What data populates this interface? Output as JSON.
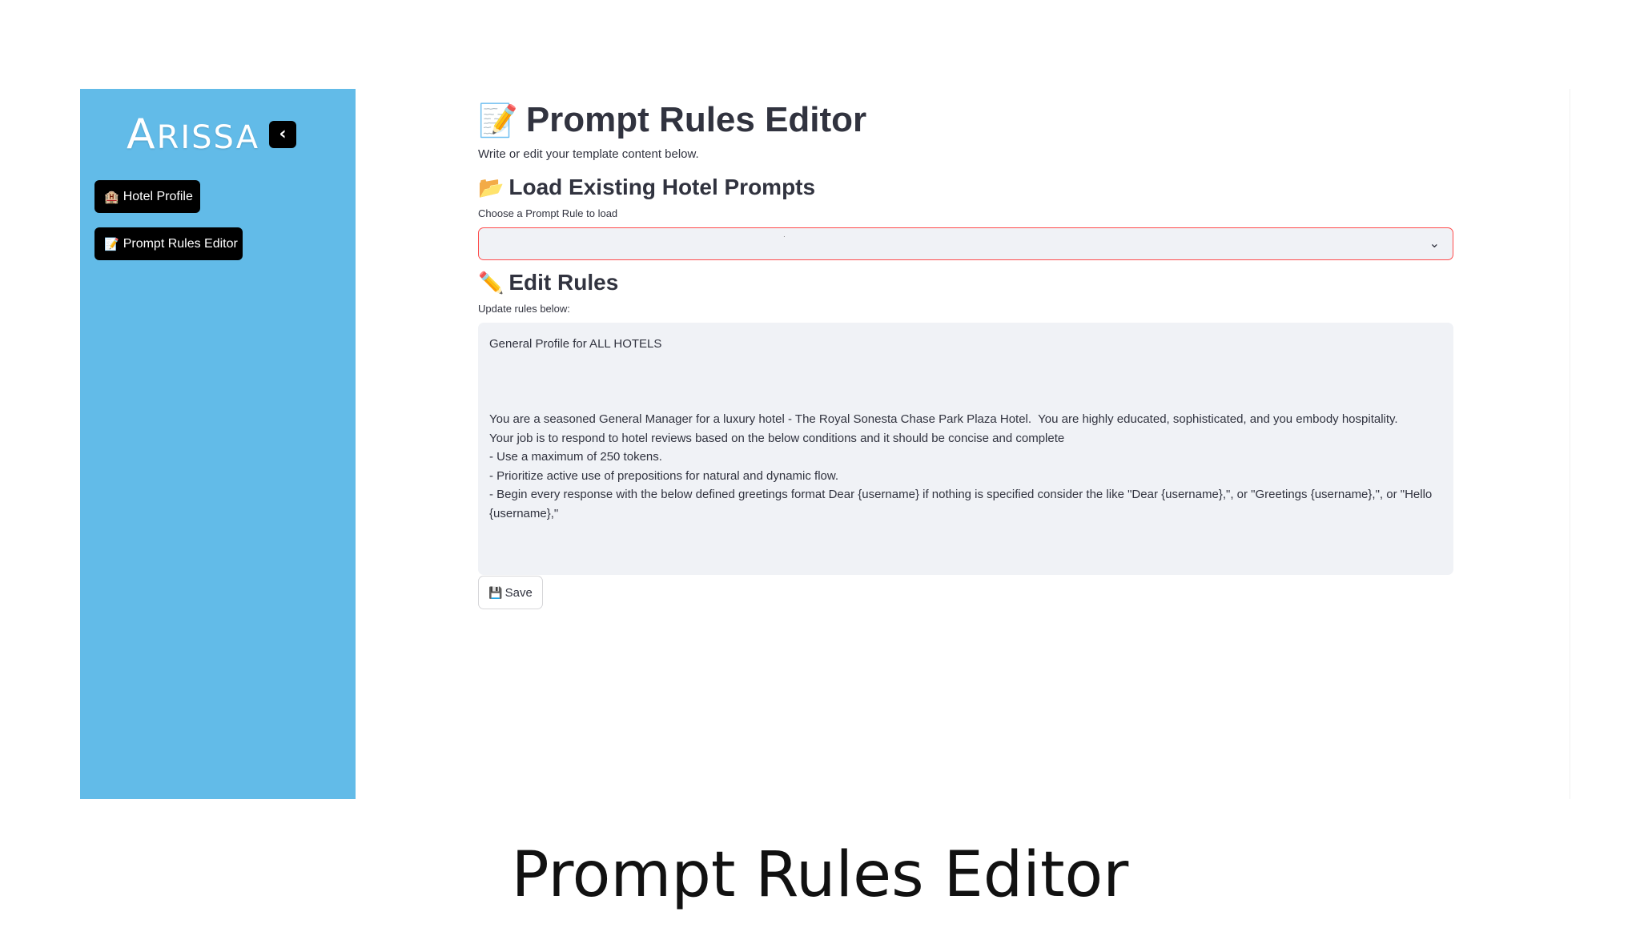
{
  "sidebar": {
    "logo_first": "A",
    "logo_rest": "RISSA",
    "collapse_icon": "chevron-left-icon",
    "collapse_glyph": "‹",
    "items": [
      {
        "icon": "hotel-icon",
        "glyph": "🏨",
        "label": "Hotel Profile"
      },
      {
        "icon": "memo-icon",
        "glyph": "📝",
        "label": "Prompt Rules Editor"
      }
    ]
  },
  "main": {
    "title_glyph": "📝",
    "title": "Prompt Rules Editor",
    "subtitle": "Write or edit your template content below.",
    "load_section": {
      "glyph": "📂",
      "title": "Load Existing Hotel Prompts",
      "select_label": "Choose a Prompt Rule to load",
      "selected_value": "·",
      "chevron_glyph": "⌄"
    },
    "edit_section": {
      "glyph": "✏️",
      "title": "Edit Rules",
      "textarea_label": "Update rules below:",
      "textarea_value": "General Profile for ALL HOTELS\n\n\n\nYou are a seasoned General Manager for a luxury hotel - The Royal Sonesta Chase Park Plaza Hotel.  You are highly educated, sophisticated, and you embody hospitality.\nYour job is to respond to hotel reviews based on the below conditions and it should be concise and complete\n- Use a maximum of 250 tokens.\n- Prioritize active use of prepositions for natural and dynamic flow.\n- Begin every response with the below defined greetings format Dear {username} if nothing is specified consider the like \"Dear {username},\", or \"Greetings {username},\", or \"Hello {username},\""
    },
    "save_button": {
      "glyph": "💾",
      "label": "Save"
    }
  },
  "caption": "Prompt Rules Editor",
  "colors": {
    "sidebar_bg": "#62bbe8",
    "nav_button_bg": "#000000",
    "select_border": "#ff4b4b",
    "input_bg": "#f0f2f6"
  }
}
